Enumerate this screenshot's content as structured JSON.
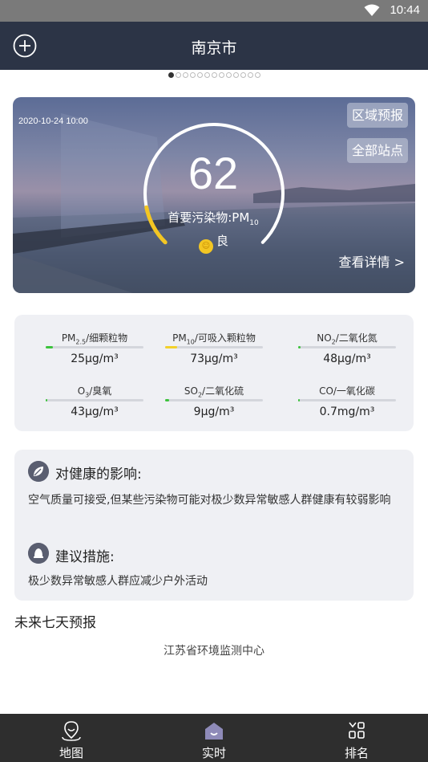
{
  "status_bar": {
    "time": "10:44",
    "wifi_icon": "wifi-icon"
  },
  "app_bar": {
    "title": "南京市",
    "add_icon": "add-circle-icon"
  },
  "pager": {
    "total": 13,
    "active_index": 0
  },
  "aqi_card": {
    "datetime": "2020-10-24 10:00",
    "region_forecast_label": "区域预报",
    "all_stations_label": "全部站点",
    "aqi_value": "62",
    "primary_pollutant_label": "首要污染物:",
    "primary_pollutant_base": "PM",
    "primary_pollutant_sub": "10",
    "level_label": "良",
    "level_color": "#f3c623",
    "detail_link": "查看详情 >",
    "gauge_fraction": 0.124
  },
  "pollutants": [
    {
      "base": "PM",
      "sub": "2.5",
      "suffix": "/细颗粒物",
      "value": "25μg/m³",
      "level": 0.07,
      "color": "#3cc33c"
    },
    {
      "base": "PM",
      "sub": "10",
      "suffix": "/可吸入颗粒物",
      "value": "73μg/m³",
      "level": 0.12,
      "color": "#f3d12a"
    },
    {
      "base": "NO",
      "sub": "2",
      "suffix": "/二氧化氮",
      "value": "48μg/m³",
      "level": 0.025,
      "color": "#3cc33c"
    },
    {
      "base": "O",
      "sub": "3",
      "suffix": "/臭氧",
      "value": "43μg/m³",
      "level": 0.01,
      "color": "#3cc33c"
    },
    {
      "base": "SO",
      "sub": "2",
      "suffix": "/二氧化硫",
      "value": "9μg/m³",
      "level": 0.04,
      "color": "#3cc33c"
    },
    {
      "base": "CO",
      "sub": "",
      "suffix": "/一氧化碳",
      "value": "0.7mg/m³",
      "level": 0.015,
      "color": "#3cc33c"
    }
  ],
  "health": {
    "effect_title": "对健康的影响:",
    "effect_text": "空气质量可接受,但某些污染物可能对极少数异常敏感人群健康有较弱影响",
    "effect_icon": "leaf-icon",
    "advice_title": "建议措施:",
    "advice_text": "极少数异常敏感人群应减少户外活动",
    "advice_icon": "bell-icon"
  },
  "forecast_title": "未来七天预报",
  "source": "江苏省环境监测中心",
  "bottom_nav": [
    {
      "label": "地图",
      "icon": "map-pin-icon"
    },
    {
      "label": "实时",
      "icon": "home-icon"
    },
    {
      "label": "排名",
      "icon": "ranking-grid-icon"
    }
  ]
}
